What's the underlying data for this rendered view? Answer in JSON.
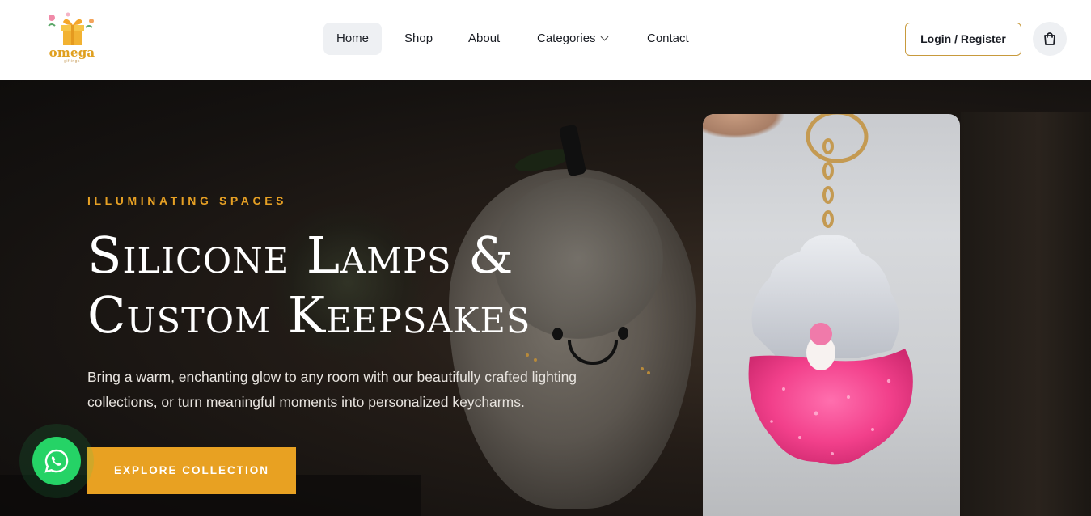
{
  "brand": {
    "name": "omega",
    "tagline": "giftings"
  },
  "nav": {
    "items": [
      {
        "label": "Home",
        "active": true
      },
      {
        "label": "Shop"
      },
      {
        "label": "About"
      },
      {
        "label": "Categories",
        "has_dropdown": true
      },
      {
        "label": "Contact"
      }
    ]
  },
  "header": {
    "login_label": "Login / Register",
    "cart_icon": "shopping-bag-icon"
  },
  "hero": {
    "kicker": "ILLUMINATING SPACES",
    "headline_line1": "Silicone Lamps &",
    "headline_line2": "Custom Keepsakes",
    "lead": "Bring a warm, enchanting glow to any room with our beautifully crafted lighting collections, or turn meaningful moments into personalized keycharms.",
    "cta_label": "EXPLORE COLLECTION"
  },
  "floating": {
    "whatsapp_icon": "whatsapp-icon"
  },
  "colors": {
    "accent": "#e8a122",
    "login_border": "#c89a3c",
    "whatsapp": "#25d366"
  }
}
